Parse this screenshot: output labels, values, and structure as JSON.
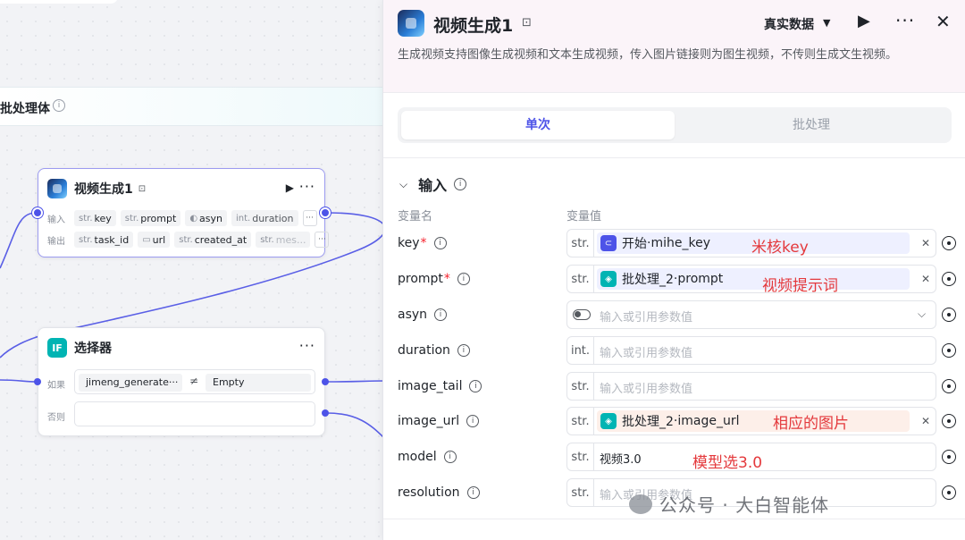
{
  "canvas": {
    "batch_title": "批处理体",
    "video_node": {
      "title": "视频生成1",
      "input_label": "输入",
      "output_label": "输出",
      "inputs": [
        {
          "type": "str.",
          "name": "key"
        },
        {
          "type": "str.",
          "name": "prompt"
        },
        {
          "type": "",
          "name": "asyn"
        },
        {
          "type": "int.",
          "name": "duration"
        }
      ],
      "outputs": [
        {
          "type": "str.",
          "name": "task_id"
        },
        {
          "type": "",
          "name": "url"
        },
        {
          "type": "str.",
          "name": "created_at"
        },
        {
          "type": "str.",
          "name": "mes..."
        }
      ],
      "more_chip": "···"
    },
    "selector_node": {
      "title": "选择器",
      "icon_text": "IF",
      "if_label": "如果",
      "else_label": "否则",
      "condition_left": "jimeng_generate···",
      "condition_op": "≠",
      "condition_right": "Empty"
    }
  },
  "panel": {
    "title": "视频生成1",
    "mode": "真实数据",
    "description": "生成视频支持图像生成视频和文本生成视频，传入图片链接则为图生视频，不传则生成文生视频。",
    "tabs": [
      {
        "label": "单次",
        "active": true
      },
      {
        "label": "批处理",
        "active": false
      }
    ],
    "section_title": "输入",
    "col_name": "变量名",
    "col_value": "变量值",
    "params": [
      {
        "name": "key",
        "required": true,
        "type": "str.",
        "ref_source": "开始",
        "ref_var": "mihe_key",
        "ref_icon": "start",
        "annotation": "米核key"
      },
      {
        "name": "prompt",
        "required": true,
        "type": "str.",
        "ref_source": "批处理_2",
        "ref_var": "prompt",
        "ref_icon": "batch",
        "annotation": "视频提示词"
      },
      {
        "name": "asyn",
        "required": false,
        "type": "toggle",
        "placeholder": "输入或引用参数值"
      },
      {
        "name": "duration",
        "required": false,
        "type": "int.",
        "placeholder": "输入或引用参数值"
      },
      {
        "name": "image_tail",
        "required": false,
        "type": "str.",
        "placeholder": "输入或引用参数值"
      },
      {
        "name": "image_url",
        "required": false,
        "type": "str.",
        "ref_source": "批处理_2",
        "ref_var": "image_url",
        "ref_icon": "batch",
        "annotation": "相应的图片"
      },
      {
        "name": "model",
        "required": false,
        "type": "str.",
        "value": "视频3.0",
        "annotation": "模型选3.0"
      },
      {
        "name": "resolution",
        "required": false,
        "type": "str.",
        "placeholder": "输入或引用参数值"
      }
    ],
    "ref_sep": " · "
  },
  "watermark": "公众号 · 大白智能体",
  "colors": {
    "accent": "#4d53e8",
    "annotation": "#e4393c",
    "batch": "#00b4b3"
  }
}
